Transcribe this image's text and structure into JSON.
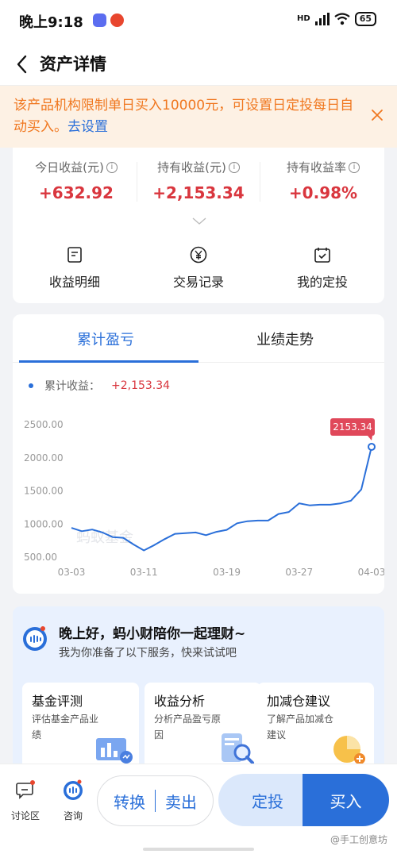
{
  "status_bar": {
    "time": "晚上9:18",
    "network": "HD",
    "battery": "65"
  },
  "nav": {
    "title": "资产详情"
  },
  "notice": {
    "text": "该产品机构限制单日买入10000元，可设置日定投每日自动买入。",
    "link": "去设置"
  },
  "summary": {
    "stats": [
      {
        "label": "今日收益(元)",
        "value": "+632.92"
      },
      {
        "label": "持有收益(元)",
        "value": "+2,153.34"
      },
      {
        "label": "持有收益率",
        "value": "+0.98%"
      }
    ],
    "actions": [
      {
        "label": "收益明细",
        "icon": "document-icon"
      },
      {
        "label": "交易记录",
        "icon": "yen-circle-icon"
      },
      {
        "label": "我的定投",
        "icon": "calendar-check-icon"
      }
    ]
  },
  "tabs": [
    "累计盈亏",
    "业绩走势"
  ],
  "legend": {
    "label": "累计收益：",
    "value": "+2,153.34"
  },
  "chart_data": {
    "type": "line",
    "series": [
      {
        "name": "累计收益",
        "values": [
          930,
          880,
          905,
          860,
          790,
          780,
          680,
          590,
          670,
          760,
          840,
          850,
          860,
          820,
          870,
          900,
          1000,
          1030,
          1040,
          1040,
          1140,
          1170,
          1300,
          1270,
          1280,
          1280,
          1300,
          1340,
          1510,
          2153.34
        ]
      }
    ],
    "x_tick_labels": [
      "03-03",
      "03-11",
      "03-19",
      "03-27",
      "04-03"
    ],
    "x_tick_index": [
      0,
      7,
      15,
      22,
      29
    ],
    "y_ticks": [
      "500.00",
      "1000.00",
      "1500.00",
      "2000.00",
      "2500.00"
    ],
    "ylim": [
      500,
      2500
    ],
    "grid": false,
    "callout": "2153.34",
    "watermark": "蚂蚁基金",
    "colors": {
      "line": "#2a6fd9",
      "callout": "#e0485a"
    }
  },
  "assistant": {
    "greeting": "晚上好，蚂小财陪你一起理财~",
    "subtitle": "我为你准备了以下服务，快来试试吧",
    "services": [
      {
        "title": "基金评测",
        "desc": "评估基金产品业绩"
      },
      {
        "title": "收益分析",
        "desc": "分析产品盈亏原因"
      },
      {
        "title": "加减仓建议",
        "desc": "了解产品加减仓建议"
      }
    ]
  },
  "bottom": {
    "discuss": "讨论区",
    "consult": "咨询",
    "switch": "转换",
    "sell": "卖出",
    "fixed": "定投",
    "buy": "买入",
    "watermark": "@手工创意坊"
  },
  "colors": {
    "accent": "#2a6fd9",
    "gain": "#d9363e",
    "notice_text": "#f0771f",
    "notice_bg": "#fdf1e4"
  }
}
